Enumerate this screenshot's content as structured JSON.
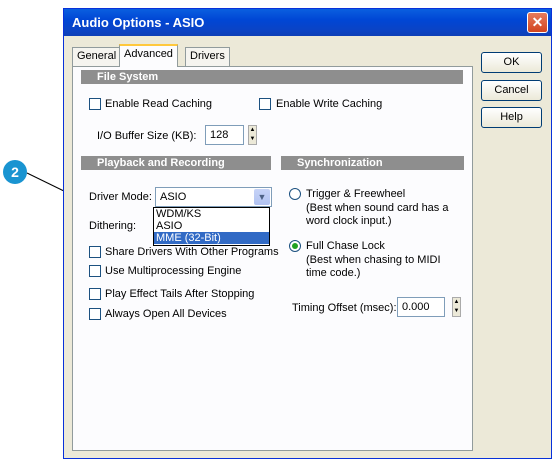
{
  "window": {
    "title": "Audio Options - ASIO"
  },
  "tabs": [
    {
      "label": "General",
      "active": false
    },
    {
      "label": "Advanced",
      "active": true
    },
    {
      "label": "Drivers",
      "active": false
    }
  ],
  "buttons": {
    "ok": "OK",
    "cancel": "Cancel",
    "help": "Help"
  },
  "file_system": {
    "heading": "File System",
    "enable_read_caching": {
      "label": "Enable Read Caching",
      "checked": false
    },
    "enable_write_caching": {
      "label": "Enable Write Caching",
      "checked": false
    },
    "io_buffer_label": "I/O Buffer Size (KB):",
    "io_buffer_value": "128"
  },
  "playback": {
    "heading": "Playback and Recording",
    "driver_mode_label": "Driver Mode:",
    "driver_mode_value": "ASIO",
    "dithering_label": "Dithering:",
    "options": [
      "WDM/KS",
      "ASIO",
      "MME (32-Bit)"
    ],
    "highlighted_option": "MME (32-Bit)",
    "checkboxes": [
      {
        "label": "Share Drivers With Other Programs",
        "checked": false
      },
      {
        "label": "Use Multiprocessing Engine",
        "checked": false
      },
      {
        "label": "Play Effect Tails After Stopping",
        "checked": false
      },
      {
        "label": "Always Open All Devices",
        "checked": false
      }
    ]
  },
  "sync": {
    "heading": "Synchronization",
    "trigger_label": "Trigger & Freewheel",
    "trigger_desc_1": "(Best when sound card has a",
    "trigger_desc_2": "word clock input.)",
    "full_chase_label": "Full Chase Lock",
    "full_chase_desc_1": "(Best when chasing to MIDI",
    "full_chase_desc_2": "time code.)",
    "selected": "Full Chase Lock",
    "timing_offset_label": "Timing Offset (msec):",
    "timing_offset_value": "0.000"
  },
  "callout": {
    "number": "2"
  },
  "colors": {
    "titlebar": "#0a5fe0",
    "section": "#8e8e8e",
    "highlight": "#316ac5",
    "callout": "#1994d1"
  }
}
